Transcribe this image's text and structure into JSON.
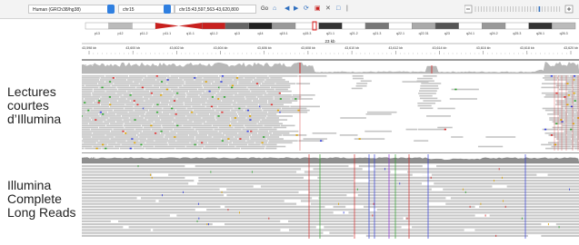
{
  "toolbar": {
    "genome": "Human (GRCh38/hg38)",
    "chromosome": "chr15",
    "locus": "chr15:43,597,563-43,620,800",
    "go_label": "Go",
    "icons": [
      "home-icon",
      "back-icon",
      "forward-icon",
      "refresh-icon",
      "region-icon",
      "close-icon",
      "popup-icon",
      "zoom-icon"
    ]
  },
  "ideogram": {
    "bands": [
      "p13",
      "p12",
      "p11.2",
      "p11.1",
      "q11.1",
      "q11.2",
      "q13",
      "q14",
      "q15.1",
      "q15.3",
      "q21.1",
      "q21.2",
      "q21.3",
      "q22.1",
      "q22.31",
      "q23",
      "q24.1",
      "q24.2",
      "q25.3",
      "q26.1",
      "q26.3"
    ]
  },
  "ruler": {
    "span_label": "23 kb",
    "ticks": [
      "43,598 kb",
      "43,600 kb",
      "43,602 kb",
      "43,604 kb",
      "43,606 kb",
      "43,608 kb",
      "43,610 kb",
      "43,612 kb",
      "43,614 kb",
      "43,616 kb",
      "43,618 kb",
      "43,620 kb"
    ]
  },
  "tracks": [
    {
      "label_lines": [
        "Lectures",
        "courtes",
        "d’Illumina"
      ],
      "scale": "[0 - 82]"
    },
    {
      "label_lines": [
        "Illumina",
        "Complete",
        "Long Reads"
      ],
      "scale": "[0 - 44]"
    }
  ],
  "colors": {
    "coverage": "#b8b8b8",
    "read_short": "#c4c4c4",
    "read_long": "#c8c8c8",
    "mismatch_a": "#2aa12a",
    "mismatch_c": "#2f3ad8",
    "mismatch_g": "#d9a000",
    "mismatch_t": "#d62a2a",
    "ideogram_centromere": "#c8201e"
  }
}
